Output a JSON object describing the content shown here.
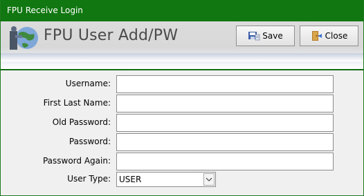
{
  "window": {
    "title": "FPU Receive Login"
  },
  "header": {
    "form_title": "FPU User Add/PW",
    "app_icon": "user-globe-icon"
  },
  "toolbar": {
    "save_label": "Save",
    "save_icon": "save-icon",
    "close_label": "Close",
    "close_icon": "close-door-icon"
  },
  "form": {
    "username_label": "Username:",
    "username_value": "",
    "first_last_name_label": "First Last Name:",
    "first_last_name_value": "",
    "old_password_label": "Old Password:",
    "old_password_value": "",
    "password_label": "Password:",
    "password_value": "",
    "password_again_label": "Password Again:",
    "password_again_value": "",
    "user_type_label": "User Type:",
    "user_type_value": "USER"
  },
  "colors": {
    "titlebar": "#117811",
    "accent_line": "#0f6a0f",
    "background": "#f0f0f0"
  }
}
